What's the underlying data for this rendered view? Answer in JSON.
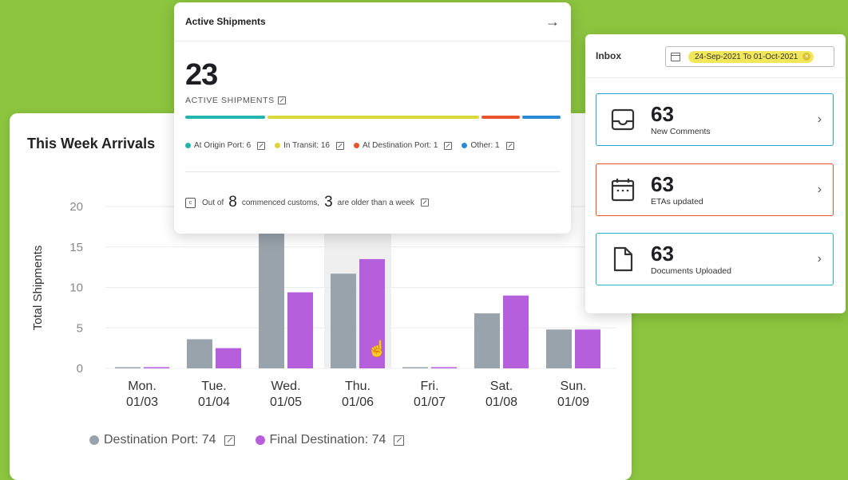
{
  "arrivals": {
    "title": "This Week Arrivals",
    "legend": [
      {
        "label": "Destination Port: 74",
        "color": "#98a3ac"
      },
      {
        "label": "Final Destination: 74",
        "color": "#b55fdc"
      }
    ]
  },
  "chart_data": {
    "type": "bar",
    "title": "This Week Arrivals",
    "xlabel": "",
    "ylabel": "Total Shipments",
    "ylim": [
      0,
      20
    ],
    "yticks": [
      0,
      5,
      10,
      15,
      20
    ],
    "categories": [
      {
        "day": "Mon.",
        "date": "01/03"
      },
      {
        "day": "Tue.",
        "date": "01/04"
      },
      {
        "day": "Wed.",
        "date": "01/05"
      },
      {
        "day": "Thu.",
        "date": "01/06"
      },
      {
        "day": "Fri.",
        "date": "01/07"
      },
      {
        "day": "Sat.",
        "date": "01/08"
      },
      {
        "day": "Sun.",
        "date": "01/09"
      }
    ],
    "series": [
      {
        "name": "Destination Port: 74",
        "color": "#98a3ac",
        "values": [
          0.1,
          3.6,
          16.8,
          11.7,
          0.1,
          6.8,
          4.8
        ]
      },
      {
        "name": "Final Destination: 74",
        "color": "#b55fdc",
        "values": [
          0.1,
          2.5,
          9.4,
          13.5,
          0.1,
          9.0,
          4.8
        ]
      }
    ],
    "highlight_category": 3,
    "grid": true,
    "legend_position": "bottom"
  },
  "active": {
    "title": "Active Shipments",
    "count": "23",
    "subtitle": "ACTIVE SHIPMENTS",
    "segments": [
      {
        "value": 6,
        "color": "#22b5ad"
      },
      {
        "value": 16,
        "color": "#d9d93c"
      },
      {
        "value": 1,
        "color": "#e8542a"
      },
      {
        "value": 1,
        "color": "#2a8ad6"
      }
    ],
    "statuses": [
      {
        "label": "At Origin Port: 6",
        "color": "#22b5ad"
      },
      {
        "label": "In Transit: 16",
        "color": "#e0d33a"
      },
      {
        "label": "At Destination Port: 1",
        "color": "#e8542a"
      },
      {
        "label": "Other: 1",
        "color": "#2a8ad6"
      }
    ],
    "customs": {
      "prefix": "Out of",
      "total": "8",
      "middle": "commenced customs,",
      "older": "3",
      "suffix": "are older than a week"
    }
  },
  "inbox": {
    "title": "Inbox",
    "date_range": "24-Sep-2021 To 01-Oct-2021",
    "items": [
      {
        "count": "63",
        "label": "New Comments",
        "icon": "inbox-tray-icon",
        "border": "#2ba3d6"
      },
      {
        "count": "63",
        "label": "ETAs updated",
        "icon": "calendar-icon",
        "border": "#e8542a"
      },
      {
        "count": "63",
        "label": "Documents Uploaded",
        "icon": "document-icon",
        "border": "#2ab3c6"
      }
    ]
  },
  "colors": {
    "background": "#8cc63f"
  }
}
